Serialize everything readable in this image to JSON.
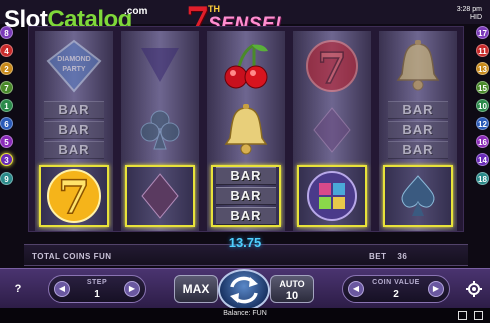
{
  "branding": {
    "site_logo_part1": "Slot",
    "site_logo_part2": "Catalog",
    "site_logo_suffix": ".com"
  },
  "game": {
    "title_number": "7",
    "title_suffix": "TH",
    "title_word": "SENSE!"
  },
  "status": {
    "time": "3:28 pm",
    "quality": "HID"
  },
  "paylines": {
    "left": [
      "8",
      "4",
      "2",
      "7",
      "1",
      "6",
      "5",
      "3",
      "9"
    ],
    "right": [
      "17",
      "11",
      "13",
      "15",
      "10",
      "12",
      "16",
      "14",
      "18"
    ],
    "highlighted_left": "3"
  },
  "reels": [
    {
      "symbols": [
        "diamond-party",
        "bar-triple",
        "lucky-7-gold"
      ]
    },
    {
      "symbols": [
        "spade",
        "club",
        "diamond-suit"
      ]
    },
    {
      "symbols": [
        "cherry",
        "bell",
        "bar-triple"
      ]
    },
    {
      "symbols": [
        "lucky-7-red",
        "diamond-suit",
        "wild-jigsaw"
      ]
    },
    {
      "symbols": [
        "bell",
        "bar-triple",
        "spade"
      ]
    }
  ],
  "bar_text": "BAR",
  "diamond_party_text": [
    "DIAMOND",
    "PARTY"
  ],
  "info": {
    "total_coins_label": "TOTAL COINS",
    "total_coins_value": "FUN",
    "bet_label": "BET",
    "bet_value": "36",
    "win_amount": "13.75"
  },
  "controls": {
    "help_label": "?",
    "step_label": "STEP",
    "step_value": "1",
    "max_label": "MAX",
    "auto_label": "AUTO",
    "auto_value": "10",
    "coin_value_label": "COIN VALUE",
    "coin_value_value": "2",
    "prev_arrow": "◀",
    "next_arrow": "▶"
  },
  "footer": {
    "balance_label": "Balance:",
    "balance_value": "FUN"
  },
  "colors": {
    "accent_win": "#e8e23a",
    "win_amount": "#4fd0ff",
    "logo_green": "#7fd83a",
    "title_red": "#e01e2a",
    "title_pink": "#ff8fd0"
  }
}
